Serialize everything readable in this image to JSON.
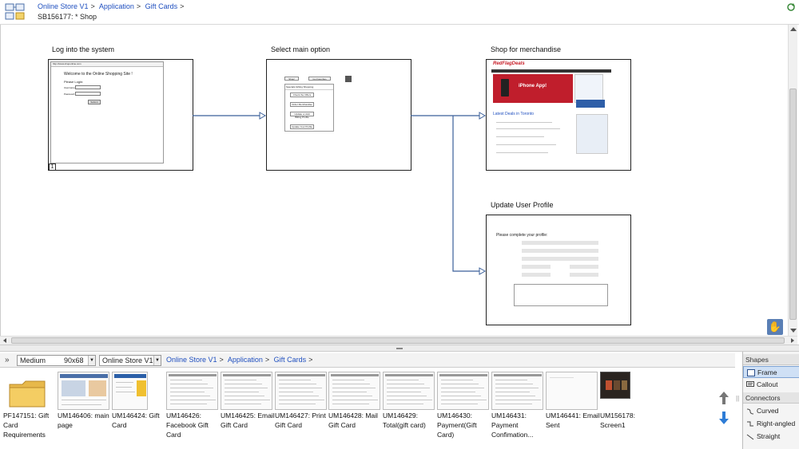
{
  "header": {
    "breadcrumb": [
      "Online Store V1",
      "Application",
      "Gift Cards"
    ],
    "trailing_sep": ">",
    "document_title": "SB156177: * Shop"
  },
  "nodes": [
    {
      "title": "Log into the system",
      "preview": "login",
      "badge": "1",
      "preview_text": {
        "url": "http://www.shoponline.com",
        "welcome": "Welcome to the Online Shopping Site !",
        "subtitle": "Please Login:",
        "username": "Username:",
        "password": "Password:",
        "button": "Submit"
      }
    },
    {
      "title": "Select main option",
      "preview": "options",
      "preview_text": {
        "top_left": "Shop!",
        "top_mid": "Go Favorites",
        "tabs": "Specials  Gifting  Shopping",
        "items": [
          "Check the Offers",
          "Order Merchandise",
          "Update or Add Billing Profile",
          "Update Your Profile"
        ]
      }
    },
    {
      "title": "Shop for merchandise",
      "preview": "shop",
      "preview_text": {
        "logo": "RedFlagDeals",
        "promo": "iPhone App!",
        "section": "Latest Deals in Toronto"
      }
    },
    {
      "title": "Update User Profile",
      "preview": "profile",
      "preview_text": {
        "heading": "Please complete your profile:"
      }
    }
  ],
  "strip": {
    "size_value": "Medium",
    "size_dims": "90x68",
    "project_value": "Online Store V1",
    "breadcrumb": [
      "Online Store V1",
      "Application",
      "Gift Cards"
    ],
    "trailing_sep": ">",
    "items": [
      {
        "id": "PF147151:",
        "name": "Gift Card Requirements",
        "kind": "folder"
      },
      {
        "id": "UM146406:",
        "name": "main page",
        "kind": "page"
      },
      {
        "id": "UM146424:",
        "name": "Gift Card",
        "kind": "site"
      },
      {
        "id": "UM146426:",
        "name": "Facebook Gift Card",
        "kind": "doc"
      },
      {
        "id": "UM146425:",
        "name": "Email Gift Card",
        "kind": "doc"
      },
      {
        "id": "UM146427:",
        "name": "Print Gift Card",
        "kind": "doc"
      },
      {
        "id": "UM146428:",
        "name": "Mail Gift Card",
        "kind": "doc"
      },
      {
        "id": "UM146429:",
        "name": "Total(gift card)",
        "kind": "doc"
      },
      {
        "id": "UM146430:",
        "name": "Payment(Gift Card)",
        "kind": "doc"
      },
      {
        "id": "UM146431:",
        "name": "Payment Confimation...",
        "kind": "doc"
      },
      {
        "id": "UM146441:",
        "name": "Email Sent",
        "kind": "blank"
      },
      {
        "id": "UM156178:",
        "name": "Screen1",
        "kind": "dark"
      }
    ]
  },
  "palette": {
    "shapes_header": "Shapes",
    "shapes": [
      "Frame",
      "Callout"
    ],
    "connectors_header": "Connectors",
    "connectors": [
      "Curved",
      "Right-angled",
      "Straight"
    ]
  },
  "colors": {
    "link": "#1f4fbf",
    "accent": "#3a5f9a",
    "selection": "#cfe0f5"
  }
}
